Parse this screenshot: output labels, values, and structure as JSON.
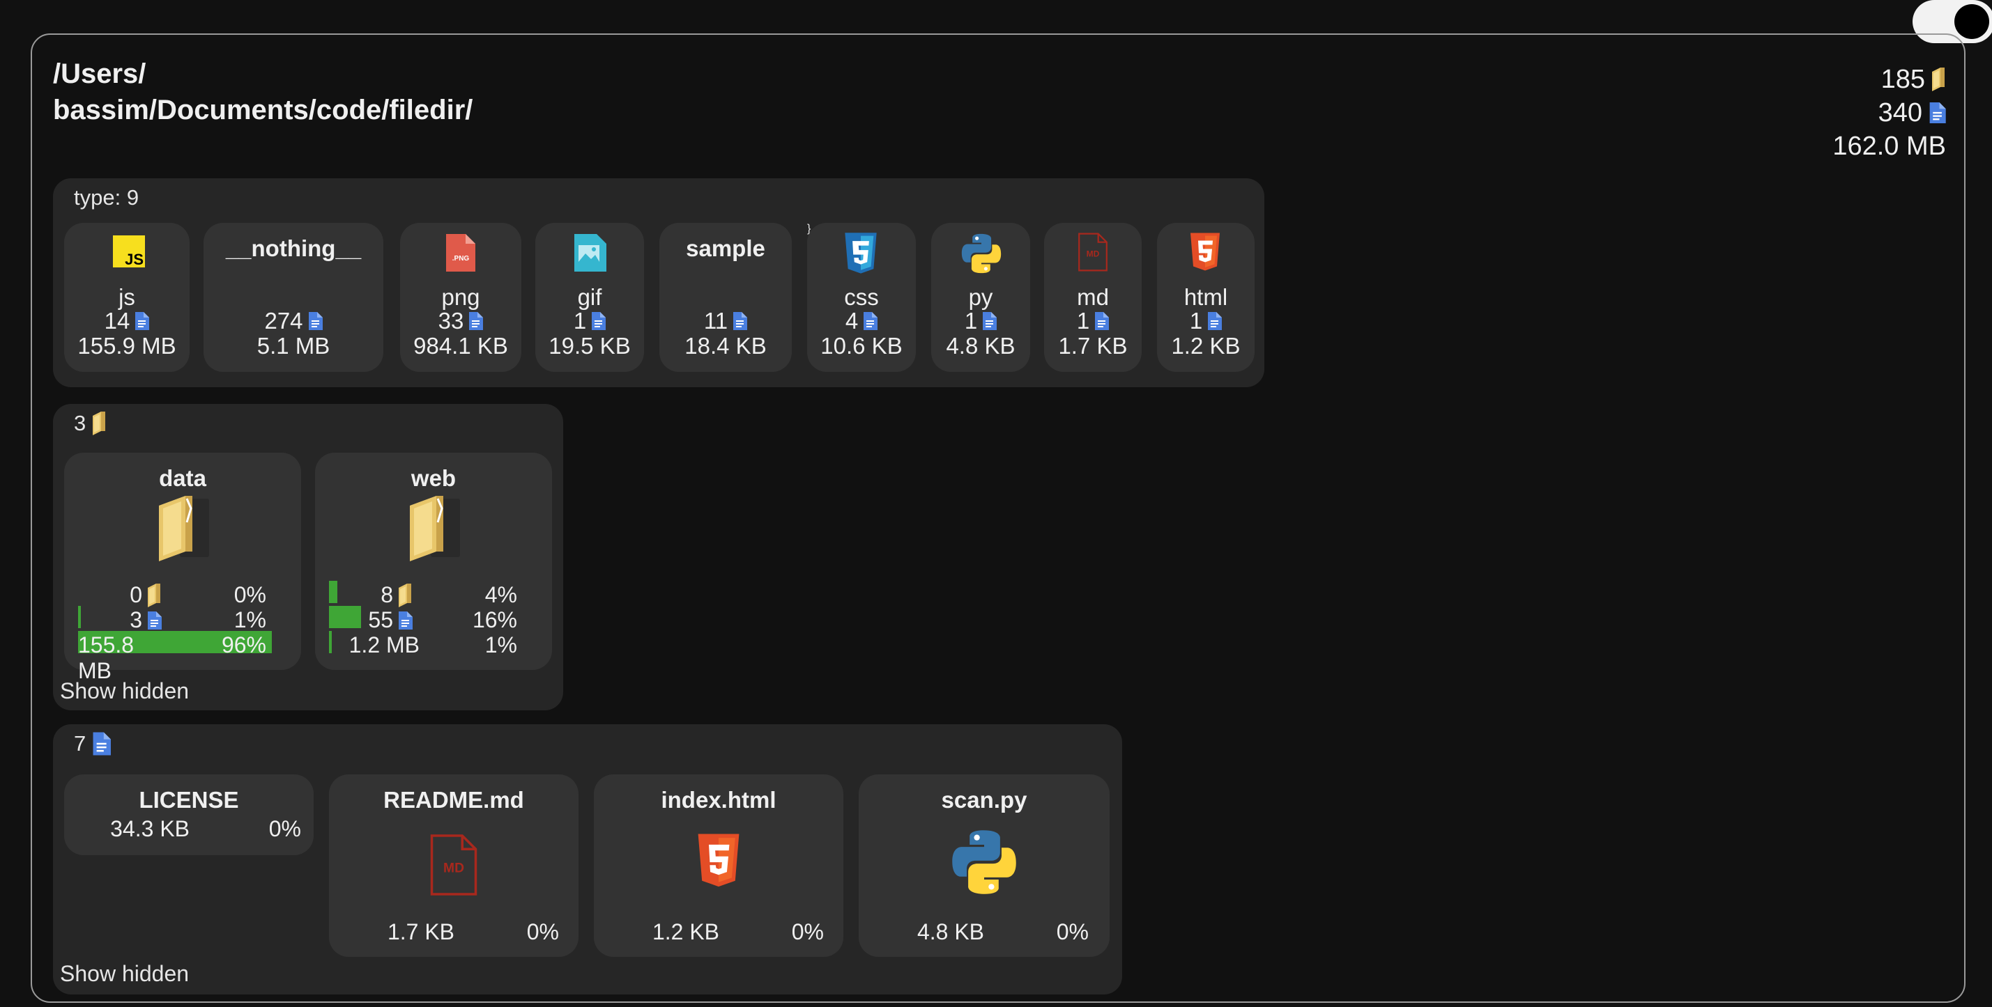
{
  "path_line1": "/Users/",
  "path_line2": "bassim/Documents/code/filedir/",
  "totals": {
    "folders": "185",
    "files": "340",
    "size": "162.0 MB"
  },
  "types_panel": {
    "header": "type: 9",
    "items": [
      {
        "name": "js",
        "count": "14",
        "size": "155.9 MB",
        "icon": "js-icon"
      },
      {
        "name": "__nothing__",
        "count": "274",
        "size": "5.1 MB",
        "icon": ""
      },
      {
        "name": "png",
        "count": "33",
        "size": "984.1 KB",
        "icon": "png-icon"
      },
      {
        "name": "gif",
        "count": "1",
        "size": "19.5 KB",
        "icon": "gif-icon"
      },
      {
        "name": "sample",
        "count": "11",
        "size": "18.4 KB",
        "icon": ""
      },
      {
        "name": "css",
        "count": "4",
        "size": "10.6 KB",
        "icon": "css-icon"
      },
      {
        "name": "py",
        "count": "1",
        "size": "4.8 KB",
        "icon": "python-icon"
      },
      {
        "name": "md",
        "count": "1",
        "size": "1.7 KB",
        "icon": "md-icon"
      },
      {
        "name": "html",
        "count": "1",
        "size": "1.2 KB",
        "icon": "html5-icon"
      }
    ]
  },
  "folders_panel": {
    "count": "3",
    "show_hidden": "Show hidden",
    "items": [
      {
        "name": "data",
        "folders": "0",
        "folders_pct": "0%",
        "files": "3",
        "files_pct": "1%",
        "size": "155.8 MB",
        "size_pct": "96%",
        "folders_fraction": 0.0,
        "files_fraction": 0.01,
        "size_fraction": 0.96
      },
      {
        "name": "web",
        "folders": "8",
        "folders_pct": "4%",
        "files": "55",
        "files_pct": "16%",
        "size": "1.2 MB",
        "size_pct": "1%",
        "folders_fraction": 0.04,
        "files_fraction": 0.16,
        "size_fraction": 0.01
      }
    ]
  },
  "files_panel": {
    "count": "7",
    "show_hidden": "Show hidden",
    "items": [
      {
        "name": "LICENSE",
        "size": "34.3 KB",
        "pct": "0%",
        "icon": ""
      },
      {
        "name": "README.md",
        "size": "1.7 KB",
        "pct": "0%",
        "icon": "md-icon"
      },
      {
        "name": "index.html",
        "size": "1.2 KB",
        "pct": "0%",
        "icon": "html5-icon"
      },
      {
        "name": "scan.py",
        "size": "4.8 KB",
        "pct": "0%",
        "icon": "python-icon"
      }
    ]
  },
  "colors": {
    "accent_bar": "#3fa636",
    "file_icon": "#4a7fe0",
    "folder_icon": "#e8c66a"
  }
}
